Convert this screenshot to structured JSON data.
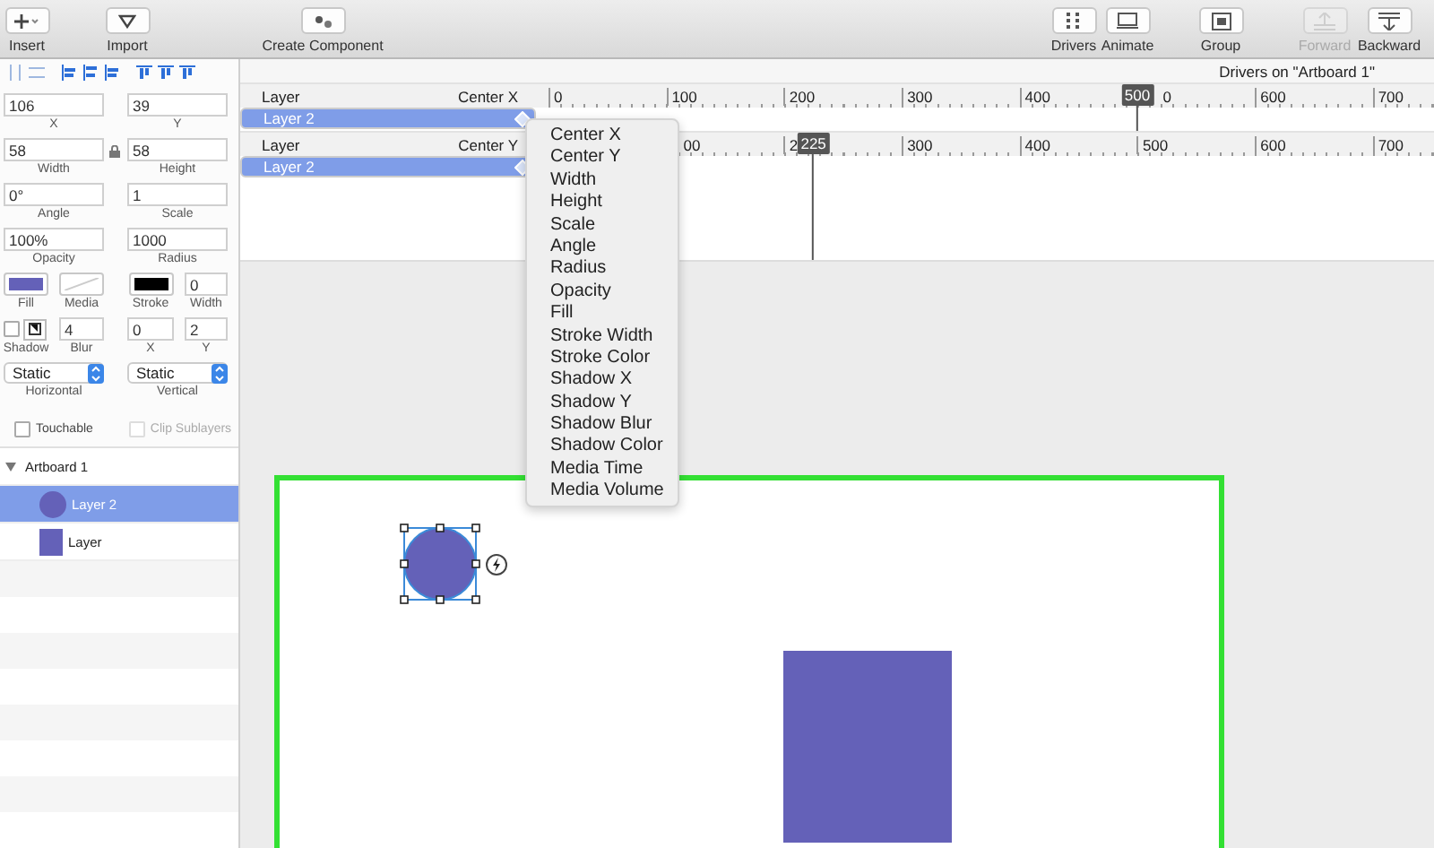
{
  "toolbar": {
    "left": [
      {
        "label": "Insert",
        "disabled": false
      },
      {
        "label": "Import",
        "disabled": false
      },
      {
        "label": "Create Component",
        "disabled": false
      }
    ],
    "right": [
      {
        "label": "Drivers",
        "disabled": false
      },
      {
        "label": "Animate",
        "disabled": false
      },
      {
        "label": "Group",
        "disabled": false
      },
      {
        "label": "Forward",
        "disabled": true
      },
      {
        "label": "Backward",
        "disabled": false
      }
    ]
  },
  "properties": {
    "fields": [
      [
        {
          "value": "106",
          "label": "X"
        },
        {
          "value": "39",
          "label": "Y"
        }
      ],
      [
        {
          "value": "58",
          "label": "Width"
        },
        {
          "value": "58",
          "label": "Height"
        }
      ],
      [
        {
          "value": "0°",
          "label": "Angle"
        },
        {
          "value": "1",
          "label": "Scale"
        }
      ],
      [
        {
          "value": "100%",
          "label": "Opacity"
        },
        {
          "value": "1000",
          "label": "Radius"
        }
      ]
    ],
    "fill": {
      "label": "Fill",
      "color": "#6461b8"
    },
    "media": {
      "label": "Media"
    },
    "stroke": {
      "label": "Stroke",
      "color": "#000000"
    },
    "stroke_width": {
      "value": "0",
      "label": "Width"
    },
    "shadow": {
      "label": "Shadow",
      "checked": false
    },
    "shadow_fields": [
      {
        "value": "4",
        "label": "Blur"
      },
      {
        "value": "0",
        "label": "X"
      },
      {
        "value": "2",
        "label": "Y"
      }
    ],
    "selects": [
      {
        "value": "Static",
        "label": "Horizontal"
      },
      {
        "value": "Static",
        "label": "Vertical"
      }
    ],
    "checkboxes": [
      {
        "label": "Touchable",
        "checked": false,
        "disabled": false
      },
      {
        "label": "Clip Sublayers",
        "checked": false,
        "disabled": true
      }
    ]
  },
  "layers": [
    {
      "name": "Artboard 1",
      "expanded": true,
      "children": [
        {
          "name": "Layer 2",
          "kind": "circle",
          "selected": true
        },
        {
          "name": "Layer",
          "kind": "rect",
          "selected": false
        }
      ]
    }
  ],
  "drivers": {
    "title": "Drivers on \"Artboard 1\"",
    "tracks": [
      {
        "layer_heading": "Layer",
        "property": "Center X",
        "layer": "Layer 2",
        "selected": true,
        "marker": "500",
        "ruler": [
          {
            "text": "0"
          },
          {
            "text": "100"
          },
          {
            "text": "200"
          },
          {
            "text": "300"
          },
          {
            "text": "400"
          },
          {
            "text": "0",
            "kind": "cut"
          },
          {
            "text": "600"
          },
          {
            "text": "700"
          }
        ]
      },
      {
        "layer_heading": "Layer",
        "property": "Center Y",
        "layer": "Layer 2",
        "selected": true,
        "marker": "225",
        "ruler": [
          {
            "text": "00",
            "kind": "cut"
          },
          {
            "text": "2"
          },
          {
            "text": "300"
          },
          {
            "text": "400"
          },
          {
            "text": "500"
          },
          {
            "text": "600"
          },
          {
            "text": "700"
          }
        ]
      }
    ]
  },
  "property_menu": [
    "Center X",
    "Center Y",
    "Width",
    "Height",
    "Scale",
    "Angle",
    "Radius",
    "Opacity",
    "Fill",
    "Stroke Width",
    "Stroke Color",
    "Shadow X",
    "Shadow Y",
    "Shadow Blur",
    "Shadow Color",
    "Media Time",
    "Media Volume"
  ],
  "canvas": {
    "shapes": [
      {
        "kind": "circle",
        "selected": true
      },
      {
        "kind": "rect",
        "selected": false
      }
    ]
  }
}
